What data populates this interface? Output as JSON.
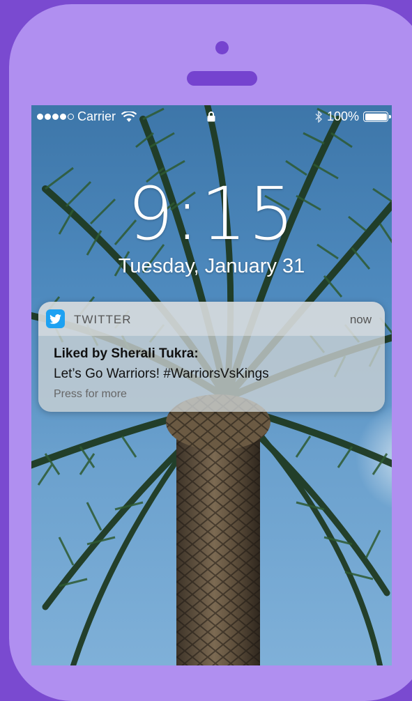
{
  "status_bar": {
    "carrier": "Carrier",
    "battery_percent": "100%",
    "signal_bars_filled": 4,
    "signal_bars_total": 5
  },
  "lock_screen": {
    "time": "9:15",
    "date": "Tuesday, January 31"
  },
  "notification": {
    "app_name": "TWITTER",
    "time": "now",
    "title": "Liked by Sherali Tukra:",
    "body": "Let’s Go Warriors! #WarriorsVsKings",
    "hint": "Press for more",
    "app_icon": "twitter-bird-icon"
  },
  "colors": {
    "background": "#7a4ad0",
    "phone_body": "#b08ff0",
    "twitter_blue": "#1da1f2"
  }
}
